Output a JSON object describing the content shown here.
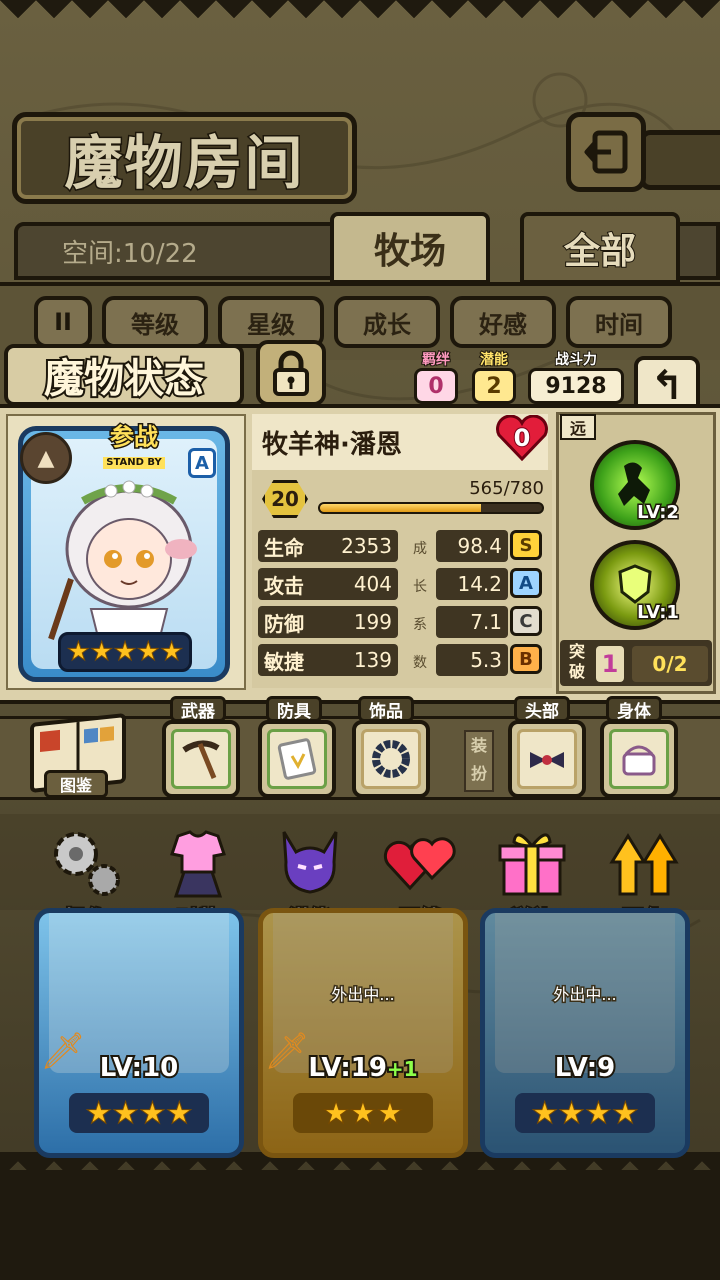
{
  "header": {
    "title": "魔物房间",
    "back_icon": "exit-arrow-icon"
  },
  "tabs": {
    "space_text": "空间:10/22",
    "items": [
      {
        "label": "牧场",
        "active": true
      },
      {
        "label": "全部",
        "active": false
      }
    ]
  },
  "sort": {
    "pause_glyph": "II",
    "buttons": [
      "等级",
      "星级",
      "成长",
      "好感",
      "时间"
    ]
  },
  "status": {
    "title": "魔物状态",
    "bond_label": "羁绊",
    "bond_value": "0",
    "potential_label": "潜能",
    "potential_value": "2",
    "power_label": "战斗力",
    "power_value": "9128",
    "return_glyph": "↰"
  },
  "monster": {
    "standby_cn": "参战",
    "standby_en": "STAND BY",
    "rank": "A",
    "stars": 5,
    "name": "牧羊神·潘恩",
    "affection": "0",
    "level": "20",
    "exp_text": "565/780",
    "exp_fraction": 0.724,
    "stats": [
      {
        "label": "生命",
        "value": "2353",
        "growth": "98.4",
        "grade": "S"
      },
      {
        "label": "攻击",
        "value": "404",
        "growth": "14.2",
        "grade": "A"
      },
      {
        "label": "防御",
        "value": "199",
        "growth": "7.1",
        "grade": "C"
      },
      {
        "label": "敏捷",
        "value": "139",
        "growth": "5.3",
        "grade": "B"
      }
    ],
    "growth_label_chars": [
      "成",
      "长",
      "系",
      "数"
    ]
  },
  "skills": {
    "range_tag": "远",
    "items": [
      {
        "icon": "shadow-figure-skill-icon",
        "level": "LV:2"
      },
      {
        "icon": "shield-skill-icon",
        "level": "LV:1"
      }
    ],
    "breakthrough_label": "突破",
    "breakthrough_count": "1",
    "breakthrough_progress": "0/2"
  },
  "equipment": {
    "book_label": "图鉴",
    "dress_label": "装扮",
    "slots": [
      {
        "label": "武器",
        "icon": "pickaxe-icon"
      },
      {
        "label": "防具",
        "icon": "scroll-armor-icon"
      },
      {
        "label": "饰品",
        "icon": "bead-bracelet-icon"
      },
      {
        "label": "头部",
        "icon": "hair-bow-icon"
      },
      {
        "label": "身体",
        "icon": "satchel-icon"
      }
    ]
  },
  "actions": [
    {
      "label": "操作",
      "icon": "gears-icon"
    },
    {
      "label": "时装",
      "icon": "outfit-icon"
    },
    {
      "label": "潜能",
      "icon": "demon-potential-icon"
    },
    {
      "label": "羁绊",
      "icon": "hearts-icon"
    },
    {
      "label": "送礼",
      "icon": "gift-icon"
    },
    {
      "label": "强化",
      "icon": "upgrade-arrows-icon"
    }
  ],
  "roster": [
    {
      "level": "LV:10",
      "plus": "",
      "status": "",
      "stars": 4
    },
    {
      "level": "LV:19",
      "plus": "+1",
      "status": "外出中...",
      "stars": 3
    },
    {
      "level": "LV:9",
      "plus": "",
      "status": "外出中...",
      "stars": 4
    }
  ],
  "colors": {
    "frame": "#1d170b",
    "panel": "#dcd1ab",
    "accent_gold": "#ffc11e",
    "bond_pink": "#b0306a"
  }
}
